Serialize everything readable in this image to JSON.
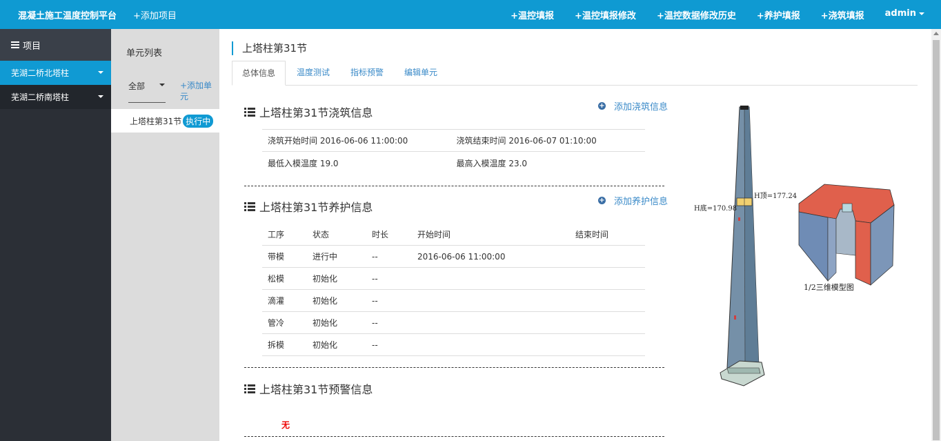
{
  "navbar": {
    "brand": "混凝土施工温度控制平台",
    "add_project": "+添加项目",
    "links": [
      "+温控填报",
      "+温控填报修改",
      "+温控数据修改历史",
      "+养护填报",
      "+浇筑填报"
    ],
    "user": "admin"
  },
  "sidebar": {
    "header": "项目",
    "items": [
      {
        "label": "芜湖二桥北塔柱"
      },
      {
        "label": "芜湖二桥南塔柱"
      }
    ]
  },
  "unit_panel": {
    "title": "单元列表",
    "filter_value": "全部",
    "add_unit": "+添加单元",
    "units": [
      {
        "name": "上塔柱第31节",
        "status": "执行中"
      }
    ]
  },
  "main": {
    "title": "上塔柱第31节",
    "tabs": [
      "总体信息",
      "温度测试",
      "指标预警",
      "编辑单元"
    ],
    "pour": {
      "title": "上塔柱第31节浇筑信息",
      "add_link": "添加浇筑信息",
      "start_label": "浇筑开始时间",
      "start_value": "2016-06-06 11:00:00",
      "end_label": "浇筑结束时间",
      "end_value": "2016-06-07 01:10:00",
      "min_label": "最低入模温度",
      "min_value": "19.0",
      "max_label": "最高入模温度",
      "max_value": "23.0"
    },
    "care": {
      "title": "上塔柱第31节养护信息",
      "add_link": "添加养护信息",
      "columns": [
        "工序",
        "状态",
        "时长",
        "开始时间",
        "结束时间"
      ],
      "rows": [
        [
          "带模",
          "进行中",
          "--",
          "2016-06-06 11:00:00",
          ""
        ],
        [
          "松模",
          "初始化",
          "--",
          "",
          ""
        ],
        [
          "滴灌",
          "初始化",
          "--",
          "",
          ""
        ],
        [
          "管冷",
          "初始化",
          "--",
          "",
          ""
        ],
        [
          "拆模",
          "初始化",
          "--",
          "",
          ""
        ]
      ]
    },
    "warning": {
      "title": "上塔柱第31节预警信息",
      "none": "无"
    }
  },
  "drawing": {
    "h_bottom": "H底=170.98",
    "h_top": "H顶=177.24",
    "model_caption": "1/2三维模型图",
    "colors": {
      "tower": "#6f8fa8",
      "model_red": "#e0604c",
      "segment": "#f0d070"
    }
  }
}
